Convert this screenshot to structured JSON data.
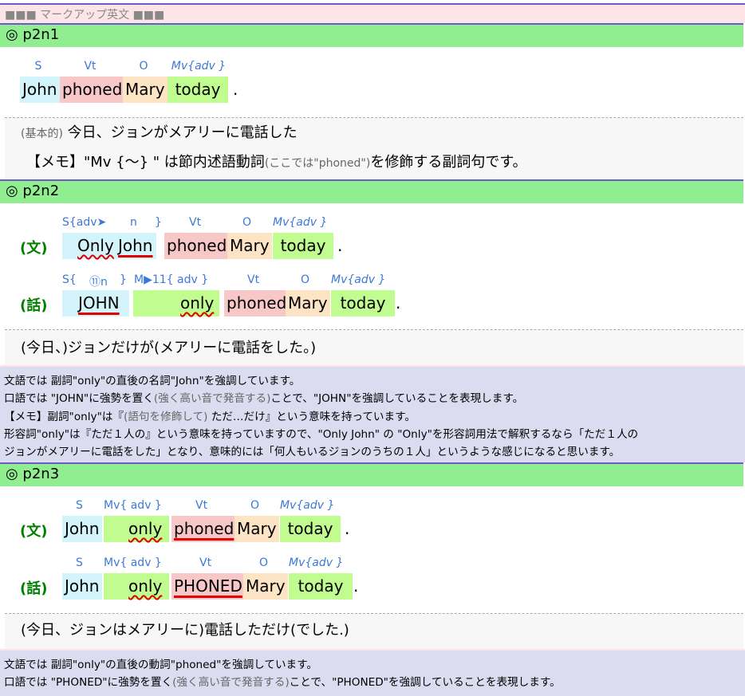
{
  "header": "■■■ マークアップ英文 ■■■",
  "sections": [
    {
      "title": "◎ p2n1",
      "roles": [
        "S",
        "Vt",
        "O",
        "Mv{adv }"
      ],
      "words": [
        "John",
        "phoned",
        "Mary",
        "today"
      ],
      "period": ".",
      "translation_prefix": "(基本的)",
      "translation": "今日、ジョンがメアリーに電話した",
      "memo_a": "【メモ】\"Mv {〜} \" は節内述語動詞",
      "memo_small": "(ここでは\"phoned\")",
      "memo_b": "を修飾する副詞句です。"
    },
    {
      "title": "◎ p2n2",
      "row1": {
        "label": "(文)",
        "roles": [
          "S{adv➤",
          "n",
          "}",
          "Vt",
          "O",
          "Mv{adv }"
        ],
        "words": [
          "Only",
          "John",
          "phoned",
          "Mary",
          "today"
        ],
        "period": "."
      },
      "row2": {
        "label": "(話)",
        "roles": [
          "S{",
          "⑪n",
          "}",
          "M▶11{ adv }",
          "Vt",
          "O",
          "Mv{adv }"
        ],
        "words": [
          "JOHN",
          "only",
          "phoned",
          "Mary",
          "today"
        ],
        "period": "."
      },
      "translation": "(今日、)ジョンだけが(メアリーに電話をした。)",
      "notes": [
        {
          "a": "文語では 副詞\"only\"の直後の名詞\"John\"を強調しています。",
          "s": "",
          "b": ""
        },
        {
          "a": "口語では \"JOHN\"に強勢を置く",
          "s": "(強く高い音で発音する)",
          "b": "ことで、\"JOHN\"を強調していることを表現します。"
        },
        {
          "a": "【メモ】副詞\"only\"は『",
          "s": "(語句を修飾して)",
          "b": " ただ…だけ』という意味を持っています。"
        },
        {
          "a": "形容詞\"only\"は『ただ１人の』という意味を持っていますので、\"Only John\" の \"Only\"を形容詞用法で解釈するなら「ただ１人の",
          "s": "",
          "b": ""
        },
        {
          "a": "ジョンがメアリーに電話をした」となり、意味的には「何人もいるジョンのうちの１人」というような感じになると思います。",
          "s": "",
          "b": ""
        }
      ]
    },
    {
      "title": "◎ p2n3",
      "row1": {
        "label": "(文)",
        "roles": [
          "S",
          "Mv{ adv }",
          "Vt",
          "O",
          "Mv{adv }"
        ],
        "words": [
          "John",
          "only",
          "phoned",
          "Mary",
          "today"
        ],
        "period": "."
      },
      "row2": {
        "label": "(話)",
        "roles": [
          "S",
          "Mv{ adv }",
          "Vt",
          "O",
          "Mv{adv }"
        ],
        "words": [
          "John",
          "only",
          "PHONED",
          "Mary",
          "today"
        ],
        "period": "."
      },
      "translation": "(今日、ジョンはメアリーに)電話しただけ(でした.)",
      "notes": [
        {
          "a": "文語では 副詞\"only\"の直後の動詞\"phoned\"を強調しています。",
          "s": "",
          "b": ""
        },
        {
          "a": "口語では \"PHONED\"に強勢を置く",
          "s": "(強く高い音で発音する)",
          "b": "ことで、\"PHONED\"を強調していることを表現します。"
        }
      ]
    }
  ],
  "colors": {
    "section_bar": "#90ee90",
    "subject": "#d4f4fc",
    "verb": "#f8c8c8",
    "object": "#fde4c4",
    "adverb": "#c0fc90",
    "role_text": "#3c78d8",
    "label": "#008000",
    "note_bg": "#dcdcf0"
  }
}
